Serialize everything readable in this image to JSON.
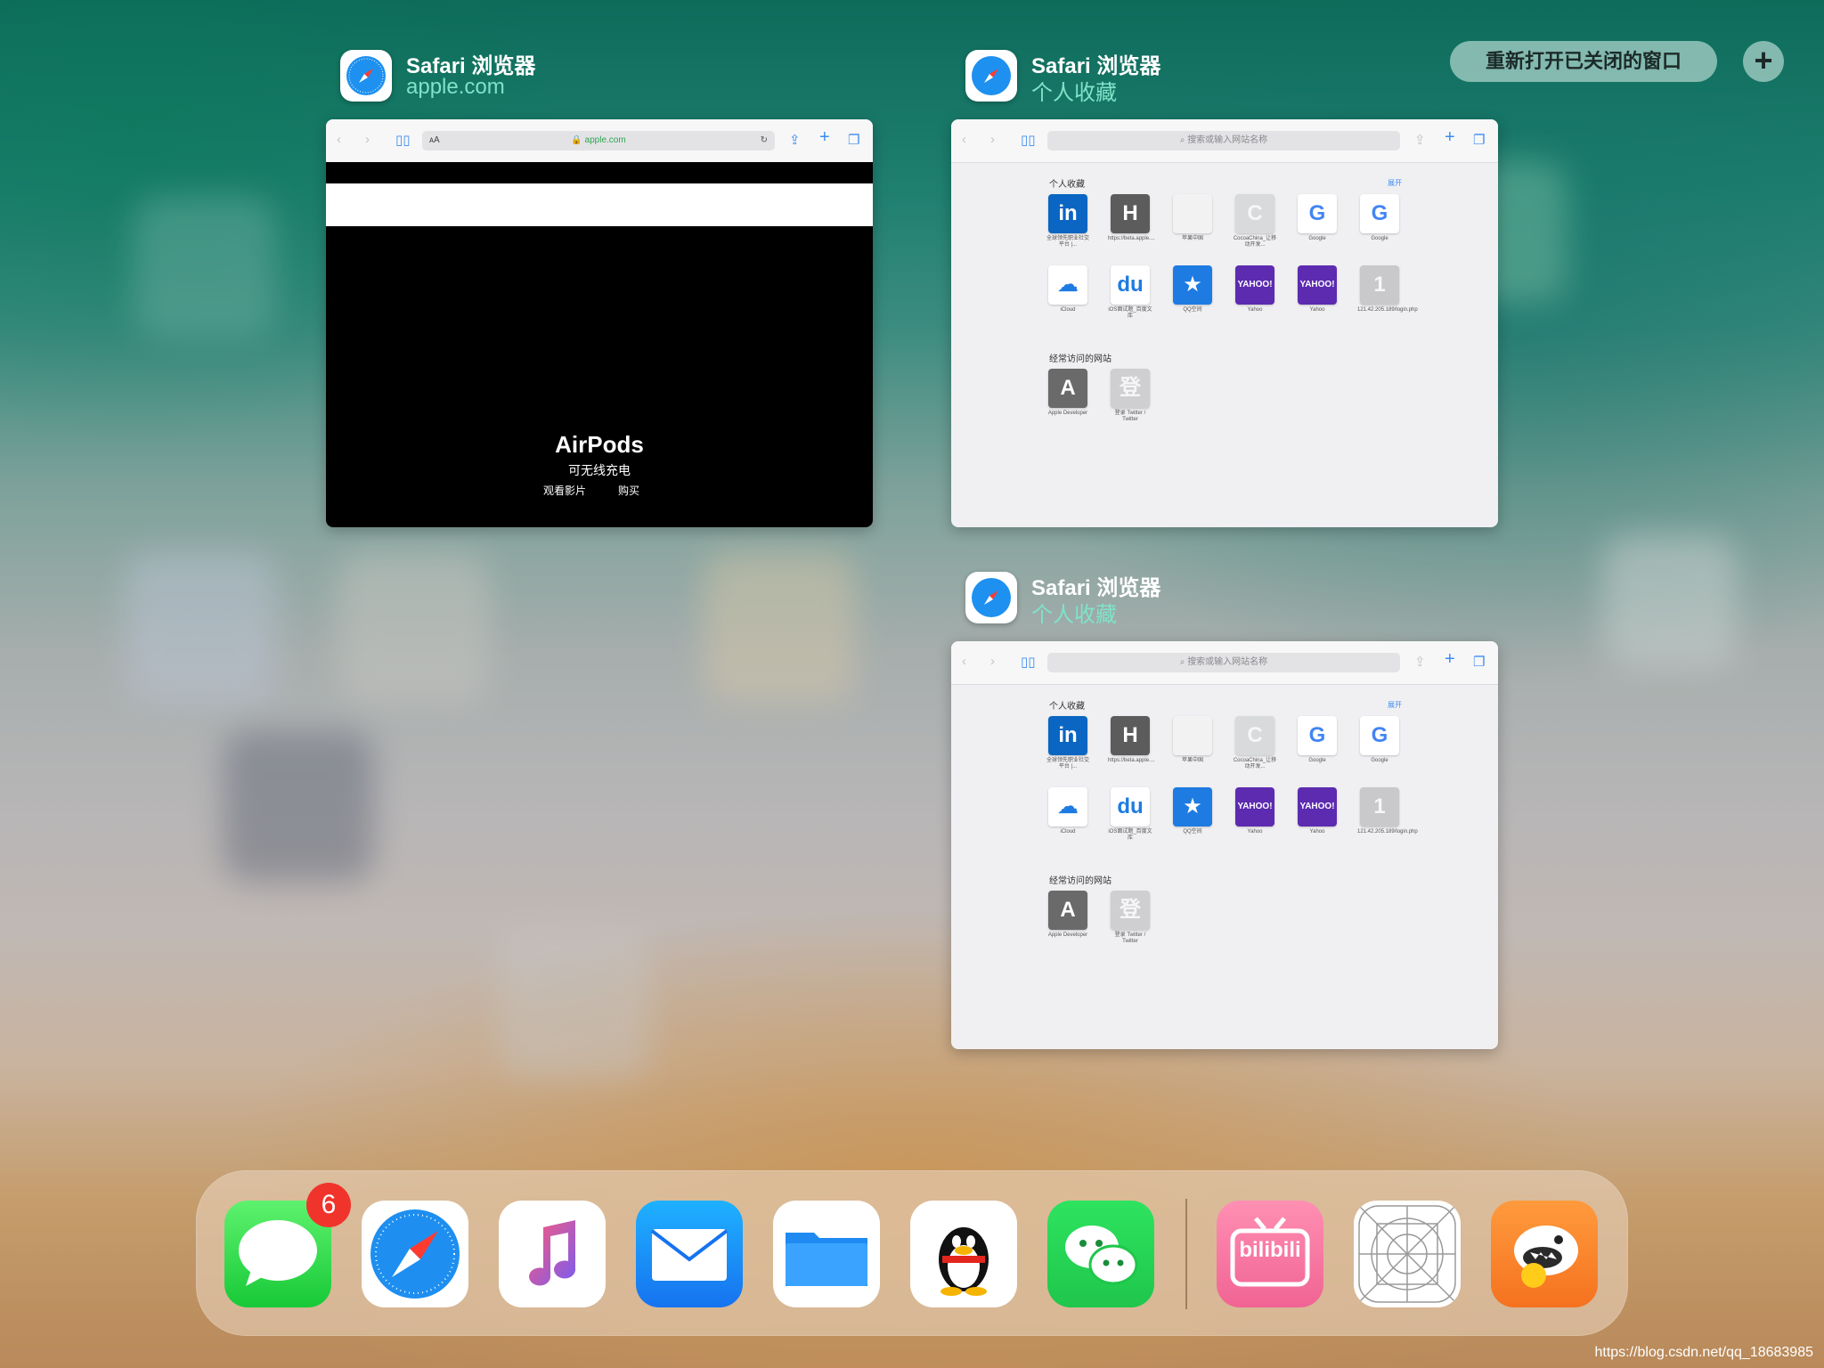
{
  "switcher": {
    "reopen_label": "重新打开已关闭的窗口",
    "add_symbol": "+",
    "windows": [
      {
        "app_name": "Safari 浏览器",
        "subtitle": "apple.com",
        "address": "apple.com",
        "page": {
          "headline": "AirPods",
          "tagline": "可无线充电",
          "link_watch": "观看影片",
          "link_buy": "购买"
        }
      },
      {
        "app_name": "Safari 浏览器",
        "subtitle": "个人收藏",
        "address": "搜索或输入网站名称"
      },
      {
        "app_name": "Safari 浏览器",
        "subtitle": "个人收藏",
        "address": "搜索或输入网站名称"
      }
    ]
  },
  "favorites": {
    "section_title": "个人收藏",
    "more_label": "展开",
    "items": [
      {
        "glyph": "in",
        "label": "全球领先职业社交平台 |...",
        "color": "#0a66c2"
      },
      {
        "glyph": "H",
        "label": "https://beta.apple....",
        "color": "#5c5c5c"
      },
      {
        "glyph": "",
        "label": "苹果中国",
        "color": "#f2f2f2"
      },
      {
        "glyph": "C",
        "label": "CocoaChina_让移动开发...",
        "color": "#d8dadc"
      },
      {
        "glyph": "G",
        "label": "Google",
        "color": "#ffffff"
      },
      {
        "glyph": "G",
        "label": "Google",
        "color": "#ffffff"
      },
      {
        "glyph": "☁",
        "label": "iCloud",
        "color": "#ffffff"
      },
      {
        "glyph": "du",
        "label": "iOS面试题_百度文库",
        "color": "#ffffff"
      },
      {
        "glyph": "★",
        "label": "QQ空间",
        "color": "#1e7be2"
      },
      {
        "glyph": "YAHOO!",
        "label": "Yahoo",
        "color": "#5c2bb0"
      },
      {
        "glyph": "YAHOO!",
        "label": "Yahoo",
        "color": "#5c2bb0"
      },
      {
        "glyph": "1",
        "label": "121.42.205.189/login.php",
        "color": "#c9c9cc"
      }
    ],
    "frequent_title": "经常访问的网站",
    "frequent": [
      {
        "glyph": "A",
        "label": "Apple Developer",
        "color": "#6a6a6a"
      },
      {
        "glyph": "登",
        "label": "登录 Twitter / Twitter",
        "color": "#cfcfd2"
      }
    ]
  },
  "dock": {
    "apps": [
      {
        "name": "Messages",
        "badge": "6"
      },
      {
        "name": "Safari"
      },
      {
        "name": "Music"
      },
      {
        "name": "Mail"
      },
      {
        "name": "Files"
      },
      {
        "name": "QQ"
      },
      {
        "name": "WeChat"
      },
      {
        "name": "bilibili",
        "glyph": "bilibili"
      },
      {
        "name": "App Icon Template"
      },
      {
        "name": "Shark game"
      }
    ]
  },
  "watermark": "https://blog.csdn.net/qq_18683985"
}
